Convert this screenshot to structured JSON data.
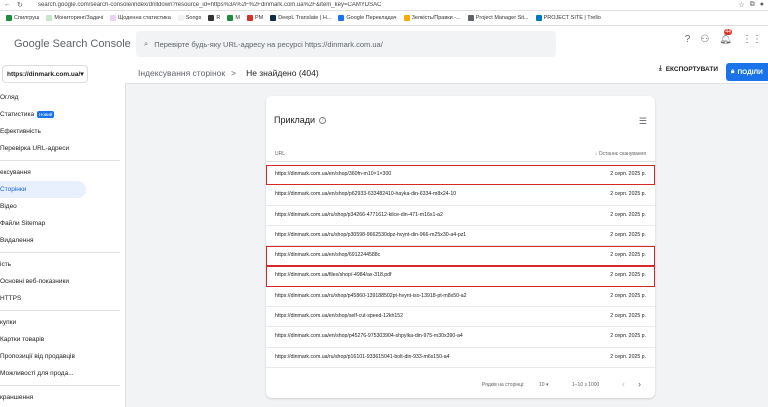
{
  "browser": {
    "url": "search.google.com/search-console/index/drilldown?resource_id=https%3A%2F%2Fdinmark.com.ua%2F&item_key=CAMYDSAC",
    "bookmarks": [
      {
        "label": "Спилгруш",
        "color": "#1e8e3e"
      },
      {
        "label": "Мониторинг/Задачі",
        "color": "#c6e7c9"
      },
      {
        "label": "Щоденна статистика",
        "color": "#e9d2f4"
      },
      {
        "label": "Songs",
        "color": "#f1f3f4"
      },
      {
        "label": "R",
        "color": "#333"
      },
      {
        "label": "M",
        "color": "#1e8e3e"
      },
      {
        "label": "PM",
        "color": "#d93025"
      },
      {
        "label": "DeepL Translate | Н...",
        "color": "#0f2b46"
      },
      {
        "label": "Google Перекладач",
        "color": "#1a73e8"
      },
      {
        "label": "Зелкість/Правки -...",
        "color": "#f9ab00"
      },
      {
        "label": "Project Manager Sit...",
        "color": "#5f6368"
      },
      {
        "label": "PROJECT SITE | Trello",
        "color": "#0079bf"
      }
    ]
  },
  "app": {
    "title": "Google Search Console",
    "search_placeholder": "Перевірте будь-яку URL-адресу на ресурсі https://dinmark.com.ua/",
    "notifications_count": "44"
  },
  "sidebar": {
    "property": "https://dinmark.com.ua/",
    "items": [
      {
        "label": "Огляд",
        "active": false
      },
      {
        "label": "Статистика",
        "active": false,
        "badge": "Новий"
      },
      {
        "label": "Ефективність",
        "active": false
      },
      {
        "label": "Перевірка URL-адреси",
        "active": false
      },
      {
        "label": "ексування",
        "active": false,
        "divider_before": true
      },
      {
        "label": "Сторінки",
        "active": true
      },
      {
        "label": "Відео",
        "active": false
      },
      {
        "label": "Файли Sitemap",
        "active": false
      },
      {
        "label": "Видалення",
        "active": false
      },
      {
        "label": "ість",
        "active": false,
        "divider_before": true
      },
      {
        "label": "Основні веб-показники",
        "active": false
      },
      {
        "label": "HTTPS",
        "active": false
      },
      {
        "label": "купки",
        "active": false,
        "divider_before": true
      },
      {
        "label": "Картки товарів",
        "active": false
      },
      {
        "label": "Пропозиції від продавців",
        "active": false
      },
      {
        "label": "Можливості для прода...",
        "active": false
      },
      {
        "label": "краншення",
        "active": false,
        "divider_before": true
      }
    ]
  },
  "breadcrumb": {
    "parent": "Індексування сторінок",
    "separator": ">",
    "current": "Не знайдено (404)"
  },
  "actions": {
    "export_label": "ЕКСПОРТУВАТИ",
    "share_label": "ПОДІЛИ"
  },
  "card": {
    "title": "Приклади",
    "col_url": "URL",
    "col_date": "Останнє сканування",
    "rows": [
      {
        "url": "https://dinmark.com.ua/en/shop/360fn-m10×1×300",
        "date": "2 серп. 2025 р.",
        "highlight": true
      },
      {
        "url": "https://dinmark.com.ua/en/shop/p62933-633482410-hayka-din-6334-m8x24-10",
        "date": "2 серп. 2025 р.",
        "highlight": false
      },
      {
        "url": "https://dinmark.com.ua/ru/shop/p34266-4771612-kilce-din-471-m16x1-a2",
        "date": "2 серп. 2025 р.",
        "highlight": false
      },
      {
        "url": "https://dinmark.com.ua/ru/shop/p30598-9662530dpz-hvynt-din-966-m25x30-a4-pz1",
        "date": "2 серп. 2025 р.",
        "highlight": false
      },
      {
        "url": "https://dinmark.com.ua/en/shop/6912244588c",
        "date": "2 серп. 2025 р.",
        "highlight": true
      },
      {
        "url": "https://dinmark.com.ua/files/shop/-4984/ax-318.pdf",
        "date": "2 серп. 2025 р.",
        "highlight": true
      },
      {
        "url": "https://dinmark.com.ua/ru/shop/p45860-139188502pt-hvynt-iso-13918-pt-m8x50-a2",
        "date": "2 серп. 2025 р.",
        "highlight": false
      },
      {
        "url": "https://dinmark.com.ua/en/shop/self-cut-speed-12kh152",
        "date": "2 серп. 2025 р.",
        "highlight": false
      },
      {
        "url": "https://dinmark.com.ua/en/shop/p45276-975303904-shpylka-din-975-m30x390-a4",
        "date": "2 серп. 2025 р.",
        "highlight": false
      },
      {
        "url": "https://dinmark.com.ua/ru/shop/p16101-933615041-bolt-din-933-m6x150-a4",
        "date": "2 серп. 2025 р.",
        "highlight": false
      }
    ],
    "footer": {
      "rows_per_page_label": "Рядків на сторінці:",
      "rows_per_page_value": "10",
      "range": "1–10 з 1000"
    }
  }
}
